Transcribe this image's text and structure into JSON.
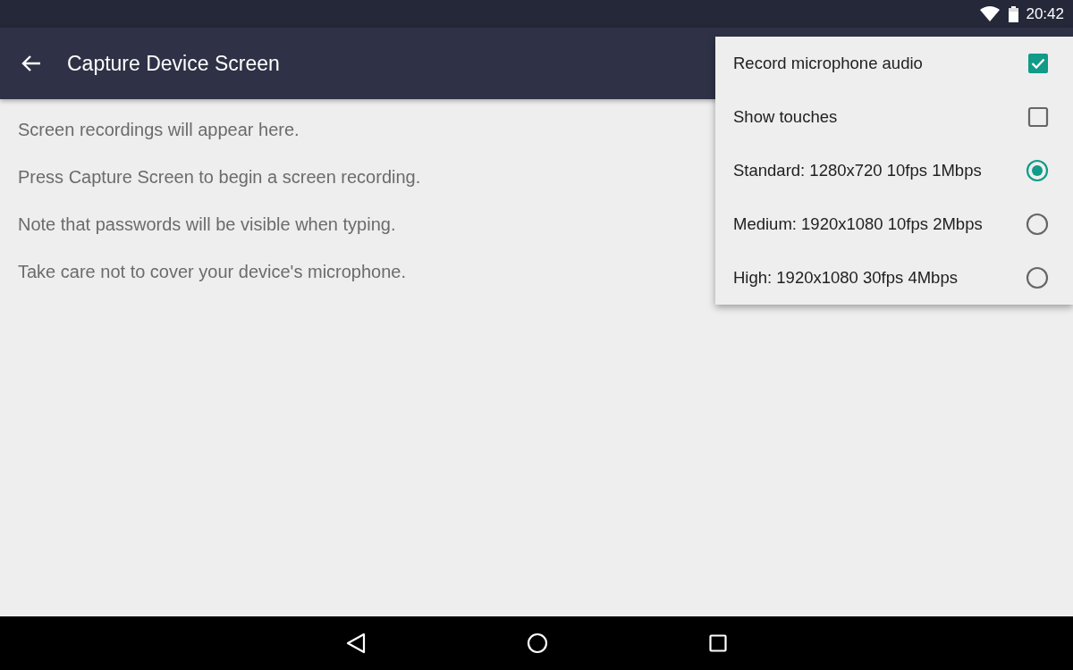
{
  "status_bar": {
    "time": "20:42"
  },
  "app_bar": {
    "title": "Capture Device Screen"
  },
  "messages": [
    "Screen recordings will appear here.",
    "Press Capture Screen to begin a screen recording.",
    "Note that passwords will be visible when typing.",
    "Take care not to cover your device's microphone."
  ],
  "menu": [
    {
      "kind": "checkbox",
      "label": "Record microphone audio",
      "checked": true
    },
    {
      "kind": "checkbox",
      "label": "Show touches",
      "checked": false
    },
    {
      "kind": "radio",
      "label": "Standard: 1280x720 10fps 1Mbps",
      "selected": true
    },
    {
      "kind": "radio",
      "label": "Medium: 1920x1080 10fps 2Mbps",
      "selected": false
    },
    {
      "kind": "radio",
      "label": "High: 1920x1080 30fps 4Mbps",
      "selected": false
    }
  ]
}
